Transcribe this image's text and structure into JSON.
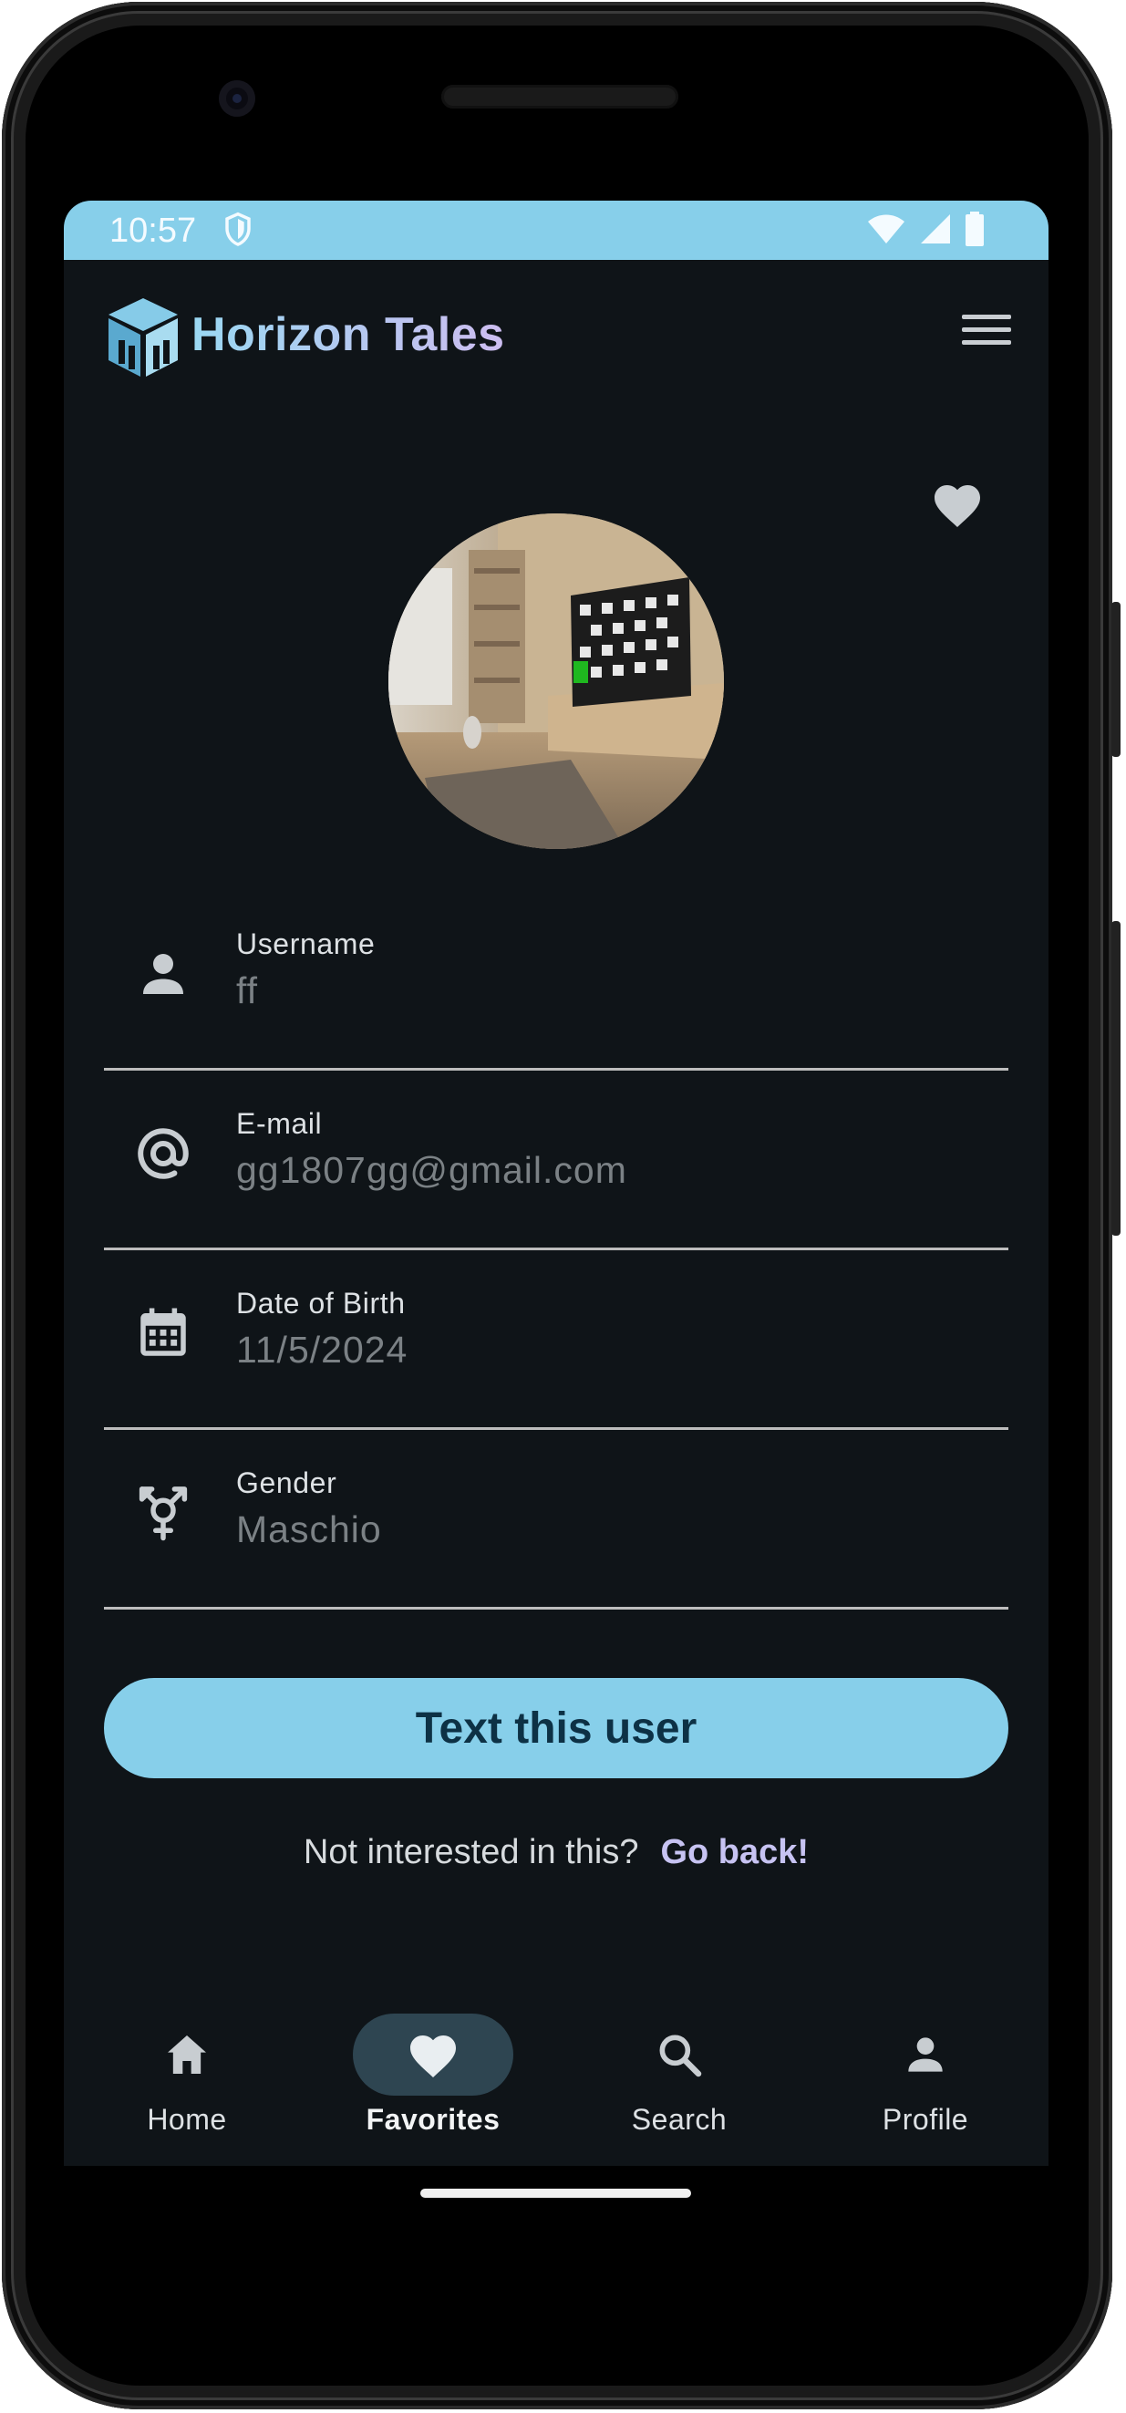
{
  "statusbar": {
    "time": "10:57",
    "icons": [
      "shield-icon",
      "wifi-icon",
      "signal-icon",
      "battery-icon"
    ]
  },
  "appbar": {
    "title": "Horizon Tales",
    "logo": "cube-logo-icon",
    "menu_icon": "menu-icon"
  },
  "profile": {
    "favorite_icon": "heart-icon",
    "fields": [
      {
        "label": "Username",
        "value": "ff",
        "icon": "person-icon"
      },
      {
        "label": "E-mail",
        "value": "gg1807gg@gmail.com",
        "icon": "at-icon"
      },
      {
        "label": "Date of Birth",
        "value": "11/5/2024",
        "icon": "calendar-icon"
      },
      {
        "label": "Gender",
        "value": "Maschio",
        "icon": "transgender-icon"
      }
    ],
    "cta_label": "Text this user",
    "footer_text": "Not interested in this?",
    "footer_link": "Go back!"
  },
  "bottom_nav": {
    "items": [
      {
        "label": "Home",
        "icon": "home-icon",
        "active": false
      },
      {
        "label": "Favorites",
        "icon": "heart-icon",
        "active": true
      },
      {
        "label": "Search",
        "icon": "search-icon",
        "active": false
      },
      {
        "label": "Profile",
        "icon": "person-icon",
        "active": false
      }
    ]
  },
  "colors": {
    "accent": "#87cfea",
    "background": "#0f1418",
    "active_pill": "#2e4551",
    "link": "#c7c3f2"
  }
}
